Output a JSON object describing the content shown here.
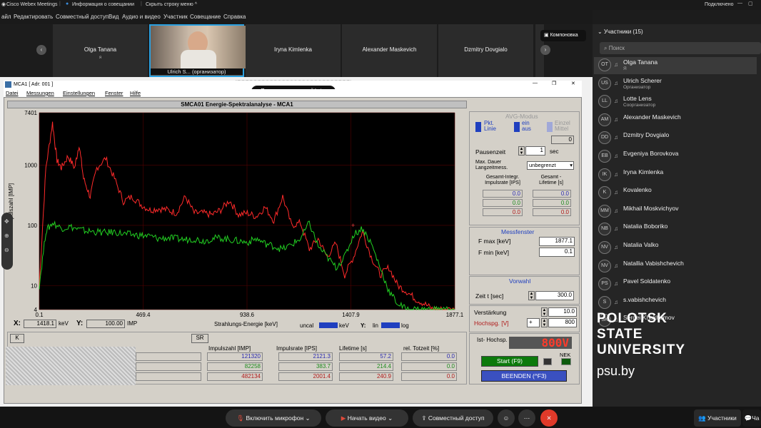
{
  "app": {
    "name": "Cisco Webex Meetings",
    "info": "Информация о совещании",
    "hide": "Скрыть строку меню",
    "status": "Подключено"
  },
  "menu": [
    "айл",
    "Редактировать",
    "Совместный доступ",
    "Вид",
    "Аудио и видео",
    "Участник",
    "Совещание",
    "Справка"
  ],
  "videos": [
    {
      "name": "Olga Tanana",
      "sub": "я"
    },
    {
      "name": "Ulrich S... (организатор)"
    },
    {
      "name": "Iryna Kimlenka"
    },
    {
      "name": "Alexander Maskevich"
    },
    {
      "name": "Dzmitry Dovgialo"
    }
  ],
  "layout_button": "Компоновка",
  "viewer_tooltip": "Просмотр приложений Lot...",
  "mca": {
    "title": "MCA1 [ Adr: 001 ]",
    "menu": [
      "Datei",
      "Messungen",
      "Einstellungen",
      "Fenster",
      "Hilfe"
    ],
    "panel_title": "SMCA01 Energie-Spektralanalyse - MCA1",
    "avg_title": "AVG-Modus",
    "pkt": "Pkt. Linie",
    "ein": "ein aus",
    "einzel": "Einzel Mittel",
    "avg_val": "0",
    "pausenzeit_label": "Pausenzeit",
    "pausenzeit_val": "1",
    "sec": "sec",
    "max_dauer": "Max. Dauer Langzeitmess.",
    "max_dauer_val": "unbegrenzt",
    "gesamt_integr": "Gesamt-Integr. Impulsrate [IPS]",
    "gesamt_lifetime": "Gesamt - Lifetime [s]",
    "zero": "0.0",
    "messfenster": "Messfenster",
    "fmax_label": "F max [keV]",
    "fmax": "1877.1",
    "fmin_label": "F min [keV]",
    "fmin": "0.1",
    "vorwahl": "Vorwahl",
    "zeit_label": "Zeit   t [sec]",
    "zeit": "300.0",
    "verstaerkung": "Verstärkung",
    "verst_val": "10.0",
    "hochspg": "Hochspg. [V]",
    "hochspg_val": "800",
    "plus": "+",
    "ist": "Ist- Hochsp.",
    "ist_val": "800V",
    "start": "Start (F9)",
    "nek": "NEK",
    "beenden": "BEENDEN (^F3)",
    "x_label": "X:",
    "x_val": "1418.1",
    "kev": "keV",
    "y_label": "Y:",
    "y_val": "100.00",
    "imp": "IMP",
    "uncal": "uncal",
    "kev2": "keV",
    "lin": "lin",
    "log": "log",
    "y_axis_label": "Impulszahl [IMP]",
    "k_btn": "K",
    "sr_btn": "SR",
    "table_headers": [
      "Impulszahl [IMP]",
      "Impulsrate [IPS]",
      "Lifetime [s]",
      "rel. Totzeit [%]"
    ],
    "table_rows": [
      {
        "imp": "121320",
        "ips": "2121.3",
        "life": "57.2",
        "tot": "0.0",
        "color": "#2a2ab0"
      },
      {
        "imp": "82258",
        "ips": "383.7",
        "life": "214.4",
        "tot": "0.0",
        "color": "#1d8a1d"
      },
      {
        "imp": "482134",
        "ips": "2001.4",
        "life": "240.9",
        "tot": "0.0",
        "color": "#b01a1a"
      }
    ]
  },
  "chart_data": {
    "type": "line",
    "xlabel": "Strahlungs-Energie [keV]",
    "ylabel": "Impulszahl [IMP]",
    "x_ticks": [
      "0.1",
      "469.4",
      "938.6",
      "1407.9",
      "1877.1"
    ],
    "y_ticks": [
      "7401",
      "1000",
      "100",
      "10",
      "4"
    ],
    "xlim": [
      0.1,
      1877.1
    ],
    "ylim": [
      4,
      7401
    ],
    "yscale": "log",
    "series": [
      {
        "color": "#ff2a2a",
        "x": [
          0.1,
          30,
          60,
          80,
          100,
          130,
          160,
          180,
          200,
          230,
          260,
          300,
          340,
          380,
          420,
          460,
          500,
          540,
          580,
          620,
          660,
          700,
          740,
          780,
          820,
          860,
          900,
          940,
          980,
          1020,
          1060,
          1100,
          1140,
          1180,
          1220,
          1260,
          1300,
          1340,
          1380,
          1420,
          1460,
          1500,
          1540,
          1580,
          1620,
          1660,
          1700,
          1740,
          1780,
          1820,
          1877
        ],
        "y": [
          10,
          900,
          5000,
          1200,
          900,
          1400,
          900,
          2200,
          600,
          300,
          900,
          1300,
          600,
          250,
          300,
          220,
          180,
          190,
          180,
          160,
          300,
          160,
          160,
          150,
          180,
          260,
          150,
          160,
          140,
          200,
          120,
          300,
          100,
          110,
          40,
          60,
          30,
          50,
          15,
          30,
          80,
          30,
          15,
          20,
          10,
          8,
          6,
          5,
          4,
          4,
          4
        ]
      },
      {
        "color": "#22d022",
        "x": [
          0.1,
          30,
          60,
          100,
          140,
          180,
          220,
          260,
          300,
          340,
          380,
          420,
          460,
          500,
          540,
          580,
          620,
          660,
          700,
          740,
          780,
          820,
          860,
          900,
          940,
          980,
          1020,
          1060,
          1100,
          1140,
          1180,
          1220,
          1260,
          1300,
          1340,
          1380,
          1420,
          1460,
          1500,
          1540,
          1580,
          1620,
          1660,
          1700,
          1740,
          1780,
          1820,
          1877
        ],
        "y": [
          10,
          80,
          110,
          90,
          95,
          85,
          80,
          78,
          75,
          78,
          72,
          70,
          68,
          66,
          60,
          62,
          60,
          58,
          60,
          55,
          60,
          62,
          58,
          55,
          52,
          60,
          50,
          45,
          40,
          48,
          60,
          110,
          45,
          30,
          20,
          30,
          70,
          90,
          50,
          20,
          8,
          5,
          4,
          4,
          4,
          4,
          4,
          4
        ]
      }
    ]
  },
  "sidebar": {
    "header": "Участники (15)",
    "search": "Поиск",
    "participants": [
      {
        "av": "OT",
        "name": "Olga Tanana",
        "role": "Я"
      },
      {
        "av": "US",
        "name": "Ulrich Scherer",
        "role": "Организатор"
      },
      {
        "av": "LL",
        "name": "Lotte Lens",
        "role": "Соорганизатор"
      },
      {
        "av": "AM",
        "name": "Alexander Maskevich",
        "role": ""
      },
      {
        "av": "DD",
        "name": "Dzmitry Dovgialo",
        "role": ""
      },
      {
        "av": "EB",
        "name": "Evgeniya Borovkova",
        "role": ""
      },
      {
        "av": "IK",
        "name": "Iryna Kimlenka",
        "role": ""
      },
      {
        "av": "K",
        "name": "Kovalenko",
        "role": ""
      },
      {
        "av": "MM",
        "name": "Mikhail Moskvichyov",
        "role": ""
      },
      {
        "av": "NB",
        "name": "Natalia Boboriko",
        "role": ""
      },
      {
        "av": "NV",
        "name": "Natalia Valko",
        "role": ""
      },
      {
        "av": "NV",
        "name": "Natallia Vabishchevich",
        "role": ""
      },
      {
        "av": "PS",
        "name": "Pavel Soldatenko",
        "role": ""
      },
      {
        "av": "S",
        "name": "s.vabishchevich",
        "role": ""
      },
      {
        "av": "SK",
        "name": "Sergei Khakhomov",
        "role": ""
      }
    ]
  },
  "logo": {
    "line1": "POLOTSK",
    "line2": "STATE",
    "line3": "UNIVERSITY",
    "site": "psu.by"
  },
  "bottom": {
    "mic": "Включить микрофон",
    "video": "Начать видео",
    "share": "Совместный доступ",
    "participants": "Участники",
    "chat": "Ча"
  }
}
